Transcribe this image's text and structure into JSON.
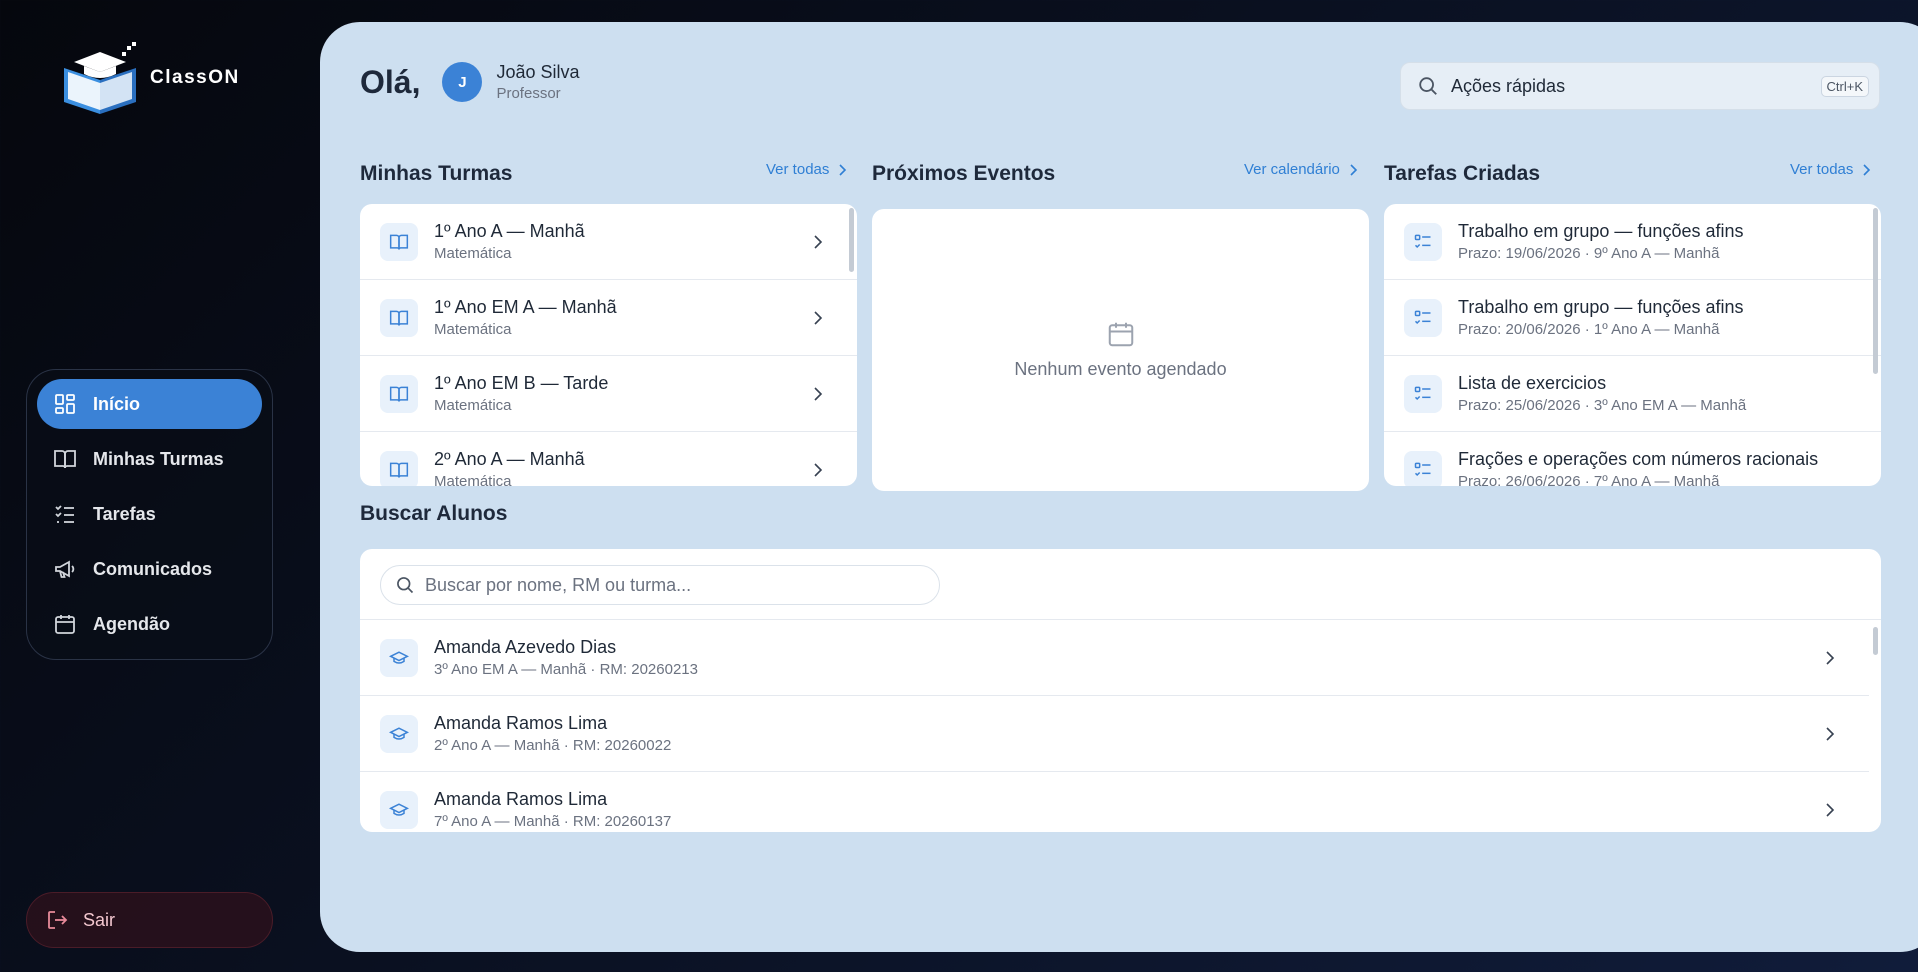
{
  "brand": {
    "name": "ClassON"
  },
  "sidebar": {
    "items": [
      {
        "label": "Início",
        "icon": "grid-icon",
        "active": true
      },
      {
        "label": "Minhas Turmas",
        "icon": "book-icon"
      },
      {
        "label": "Tarefas",
        "icon": "checklist-icon"
      },
      {
        "label": "Comunicados",
        "icon": "megaphone-icon"
      },
      {
        "label": "Agendão",
        "icon": "calendar-icon"
      }
    ],
    "logout_label": "Sair"
  },
  "header": {
    "greeting": "Olá,",
    "avatar_initial": "J",
    "user_name": "João Silva",
    "user_role": "Professor",
    "quick_actions_label": "Ações rápidas",
    "quick_actions_shortcut": "Ctrl+K"
  },
  "turmas": {
    "title": "Minhas Turmas",
    "link": "Ver todas",
    "items": [
      {
        "title": "1º Ano A — Manhã",
        "subtitle": "Matemática"
      },
      {
        "title": "1º Ano EM A — Manhã",
        "subtitle": "Matemática"
      },
      {
        "title": "1º Ano EM B — Tarde",
        "subtitle": "Matemática"
      },
      {
        "title": "2º Ano A — Manhã",
        "subtitle": "Matemática"
      }
    ]
  },
  "eventos": {
    "title": "Próximos Eventos",
    "link": "Ver calendário",
    "empty_text": "Nenhum evento agendado"
  },
  "tarefas": {
    "title": "Tarefas Criadas",
    "link": "Ver todas",
    "items": [
      {
        "title": "Trabalho em grupo — funções afins",
        "subtitle": "Prazo: 19/06/2026 · 9º Ano A — Manhã"
      },
      {
        "title": "Trabalho em grupo — funções afins",
        "subtitle": "Prazo: 20/06/2026 · 1º Ano A — Manhã"
      },
      {
        "title": "Lista de exercicios",
        "subtitle": "Prazo: 25/06/2026 · 3º Ano EM A — Manhã"
      },
      {
        "title": "Frações e operações com números racionais",
        "subtitle": "Prazo: 26/06/2026 · 7º Ano A — Manhã"
      }
    ]
  },
  "alunos": {
    "title": "Buscar Alunos",
    "search_placeholder": "Buscar por nome, RM ou turma...",
    "items": [
      {
        "name": "Amanda Azevedo Dias",
        "detail": "3º Ano EM A — Manhã · RM: 20260213"
      },
      {
        "name": "Amanda Ramos Lima",
        "detail": "2º Ano A — Manhã · RM: 20260022"
      },
      {
        "name": "Amanda Ramos Lima",
        "detail": "7º Ano A — Manhã · RM: 20260137"
      }
    ]
  },
  "colors": {
    "accent": "#3b82d6",
    "panel": "#cddff0",
    "link": "#2f7fd4"
  }
}
